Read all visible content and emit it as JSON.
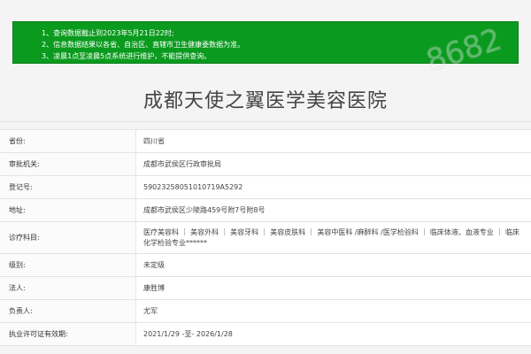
{
  "notice": {
    "lines": [
      "1、查询数据截止到2023年5月21日22时;",
      "2、信息数据结果以各省、自治区、直辖市卫生健康委数据为准。",
      "3、凌晨1点至凌晨5点系统进行维护，不能提供查询。"
    ]
  },
  "watermark": "8682",
  "title": "成都天使之翼医学美容医院",
  "rows": [
    {
      "label": "省份:",
      "value": "四川省"
    },
    {
      "label": "审批机关:",
      "value": "成都市武侯区行政审批局"
    },
    {
      "label": "登记号:",
      "value": "59023258051010719A5292"
    },
    {
      "label": "地址:",
      "value": "成都市武侯区少陵路459号附7号附8号"
    },
    {
      "label": "诊疗科目:",
      "value": "医疗美容科 ｜ 美容外科 ｜ 美容牙科 ｜ 美容皮肤科 ｜ 美容中医科 /麻醉科 /医学检验科 ｜ 临床体液、血液专业 ｜ 临床化学检验专业******"
    },
    {
      "label": "级别:",
      "value": "未定级"
    },
    {
      "label": "法人:",
      "value": "康胜博"
    },
    {
      "label": "负责人:",
      "value": "尤军"
    },
    {
      "label": "执业许可证有效期:",
      "value": "2021/1/29 -至- 2026/1/28"
    }
  ],
  "colors": {
    "notice_bg": "#0a9b1e",
    "label_bg": "#fbfbfb",
    "border": "#e3e3e3"
  }
}
